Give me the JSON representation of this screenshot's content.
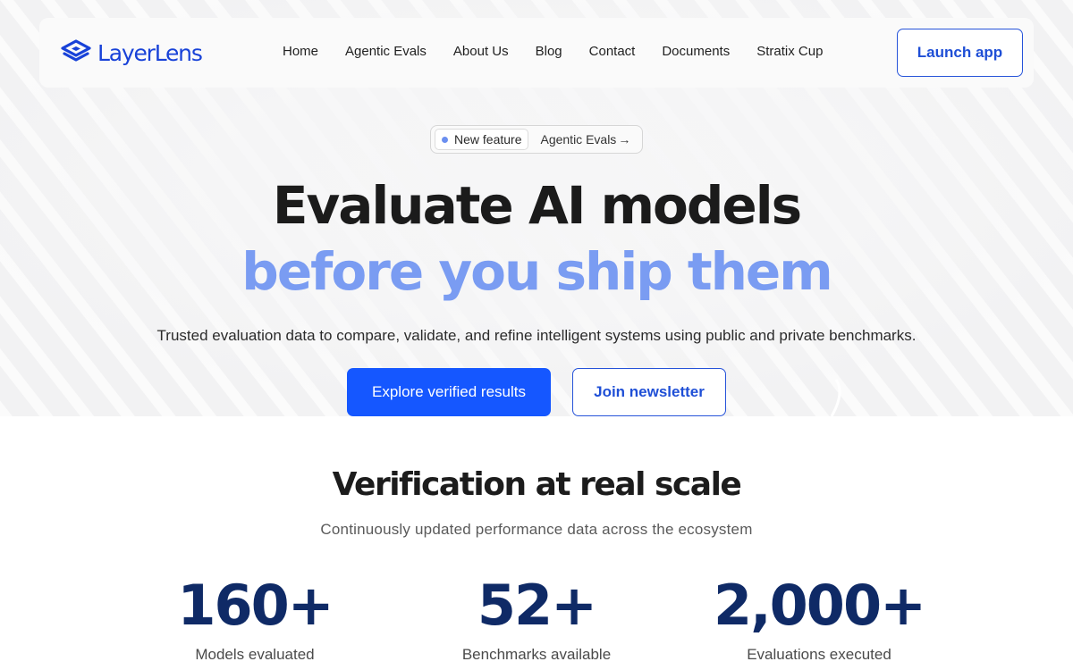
{
  "brand": {
    "name": "LayerLens",
    "logo_icon": "stacked-layers-icon",
    "accent": "#1842d8",
    "primary_button": "#1557ff",
    "highlight": "#7a9cf2",
    "stat_color": "#0f2a66"
  },
  "nav": {
    "links": [
      "Home",
      "Agentic Evals",
      "About Us",
      "Blog",
      "Contact",
      "Documents",
      "Stratix Cup"
    ],
    "launch_label": "Launch app"
  },
  "hero": {
    "pill_tag": "New feature",
    "pill_text": "Agentic Evals",
    "pill_arrow": "→",
    "headline_1": "Evaluate AI models",
    "headline_2": "before you ship them",
    "subtitle": "Trusted evaluation data to compare, validate, and refine intelligent systems using public and private benchmarks.",
    "primary_cta": "Explore verified results",
    "secondary_cta": "Join newsletter"
  },
  "stats_section": {
    "title": "Verification at real scale",
    "subtitle": "Continuously updated performance data across the ecosystem",
    "stats": [
      {
        "value": "160+",
        "label": "Models evaluated"
      },
      {
        "value": "52+",
        "label": "Benchmarks available"
      },
      {
        "value": "2,000+",
        "label": "Evaluations executed"
      }
    ]
  }
}
